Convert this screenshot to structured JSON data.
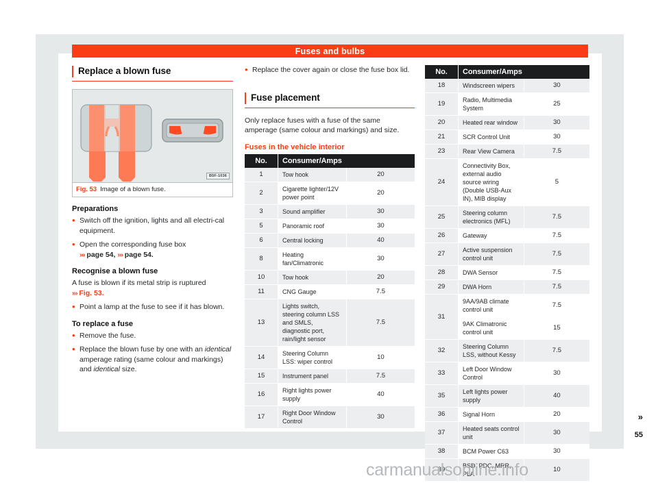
{
  "chapter_title": "Fuses and bulbs",
  "page_number": "55",
  "continuation_marker": "»",
  "watermark": "carmanualsonline.info",
  "left_column": {
    "heading": "Replace a blown fuse",
    "figure": {
      "code": "B5F-1036",
      "caption_label": "Fig. 53",
      "caption_text": "Image of a blown fuse."
    },
    "sections": [
      {
        "heading": "Preparations",
        "paragraphs": [
          {
            "bullet": true,
            "text": "Switch off the ignition, lights and all electri-cal equipment."
          },
          {
            "bullet": true,
            "text": "Open the corresponding fuse box",
            "xref": "››› page 54, ››› page 54."
          }
        ]
      },
      {
        "heading": "Recognise a blown fuse",
        "paragraphs": [
          {
            "bullet": false,
            "text": "A fuse is blown if its metal strip is ruptured",
            "xref": "››› Fig. 53."
          },
          {
            "bullet": true,
            "text": "Point a lamp at the fuse to see if it has blown."
          }
        ]
      },
      {
        "heading": "To replace a fuse",
        "paragraphs": [
          {
            "bullet": true,
            "text": "Remove the fuse."
          },
          {
            "bullet": true,
            "text": "Replace the blown fuse by one with an identical amperage rating (same colour and markings) and identical size."
          }
        ]
      }
    ]
  },
  "middle_column": {
    "intro_bullet": "Replace the cover again or close the fuse box lid.",
    "heading": "Fuse placement",
    "body": "Only replace fuses with a fuse of the same amperage (same colour and markings) and size.",
    "table_title": "Fuses in the vehicle interior",
    "table": {
      "columns": [
        "No.",
        "Consumer/Amps"
      ],
      "rows": [
        {
          "no": "1",
          "desc": "Tow hook",
          "amps": "20"
        },
        {
          "no": "2",
          "desc": "Cigarette lighter/12V power point",
          "amps": "20"
        },
        {
          "no": "3",
          "desc": "Sound amplifier",
          "amps": "30"
        },
        {
          "no": "5",
          "desc": "Panoramic roof",
          "amps": "30"
        },
        {
          "no": "6",
          "desc": "Central locking",
          "amps": "40"
        },
        {
          "no": "8",
          "desc": "Heating fan/Climatronic",
          "amps": "30"
        },
        {
          "no": "10",
          "desc": "Tow hook",
          "amps": "20"
        },
        {
          "no": "11",
          "desc": "CNG Gauge",
          "amps": "7.5"
        },
        {
          "no": "13",
          "desc": "Lights switch, steering column LSS and SMLS, diagnostic port, rain/light sensor",
          "amps": "7.5"
        },
        {
          "no": "14",
          "desc": "Steering Column LSS: wiper control",
          "amps": "10"
        },
        {
          "no": "15",
          "desc": "Instrument panel",
          "amps": "7.5"
        },
        {
          "no": "16",
          "desc": "Right lights power supply",
          "amps": "40"
        },
        {
          "no": "17",
          "desc": "Right Door Window Control",
          "amps": "30"
        }
      ]
    }
  },
  "right_column": {
    "table": {
      "columns": [
        "No.",
        "Consumer/Amps"
      ],
      "rows": [
        {
          "no": "18",
          "desc": "Windscreen wipers",
          "amps": "30"
        },
        {
          "no": "19",
          "desc": "Radio, Multimedia System",
          "amps": "25"
        },
        {
          "no": "20",
          "desc": "Heated rear window",
          "amps": "30"
        },
        {
          "no": "21",
          "desc": "SCR Control Unit",
          "amps": "30"
        },
        {
          "no": "23",
          "desc": "Rear View Camera",
          "amps": "7.5"
        },
        {
          "no": "24",
          "desc": "Connectivity Box, external audio source wiring (Double USB-Aux IN), MIB display",
          "amps": "5"
        },
        {
          "no": "25",
          "desc": "Steering column electronics (MFL)",
          "amps": "7.5"
        },
        {
          "no": "26",
          "desc": "Gateway",
          "amps": "7.5"
        },
        {
          "no": "27",
          "desc": "Active suspension control unit",
          "amps": "7.5"
        },
        {
          "no": "28",
          "desc": "DWA Sensor",
          "amps": "7.5"
        },
        {
          "no": "29",
          "desc": "DWA Horn",
          "amps": "7.5"
        },
        {
          "no": "31",
          "desc": "9AA/9AB climate control unit",
          "amps": "7.5",
          "sub": {
            "desc": "9AK Climatronic control unit",
            "amps": "15"
          }
        },
        {
          "no": "32",
          "desc": "Steering Column LSS, without Kessy",
          "amps": "7.5"
        },
        {
          "no": "33",
          "desc": "Left Door Window Control",
          "amps": "30"
        },
        {
          "no": "35",
          "desc": "Left lights power supply",
          "amps": "40"
        },
        {
          "no": "36",
          "desc": "Signal Horn",
          "amps": "20"
        },
        {
          "no": "37",
          "desc": "Heated seats control unit",
          "amps": "30"
        },
        {
          "no": "38",
          "desc": "BCM Power C63",
          "amps": "30"
        },
        {
          "no": "39",
          "desc": "BSD, PDC, MRR, PLA",
          "amps": "10"
        }
      ]
    }
  },
  "colors": {
    "accent": "#fa3c17",
    "header_dark": "#1b1d1f",
    "row_shade": "#eceeef",
    "page_backdrop": "#e6e9ea"
  }
}
